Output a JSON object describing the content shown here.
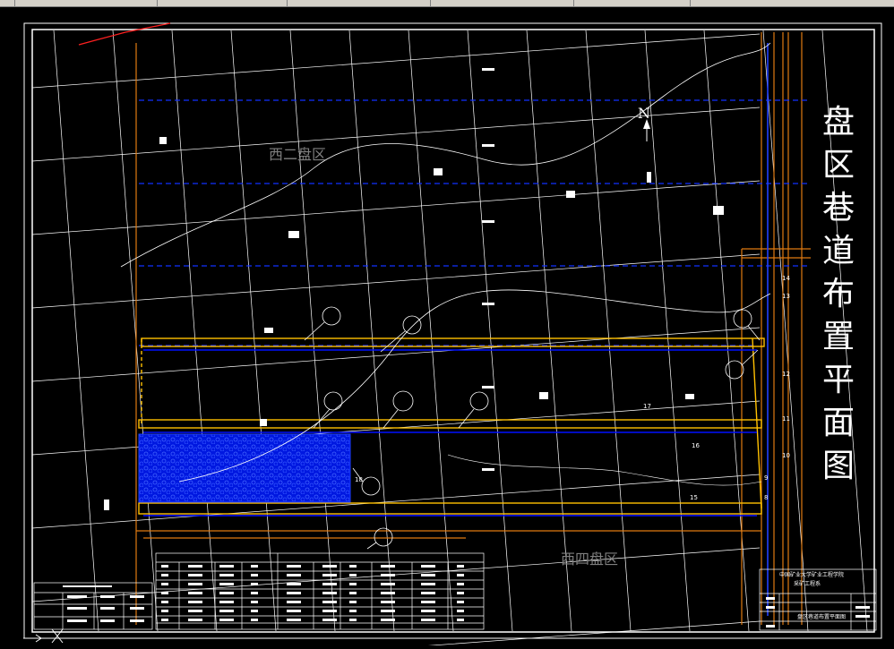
{
  "window": {
    "toolbar_visible": true
  },
  "drawing": {
    "title_chars": [
      "盘",
      "区",
      "巷",
      "道",
      "布",
      "置",
      "平",
      "面",
      "图"
    ],
    "panel_labels": [
      "西二盘区",
      "西四盘区"
    ],
    "north_label": "N",
    "school_line": "中国矿业大学矿业工程学院",
    "major_line": "采矿工程系",
    "sheet_name": "盘区巷道布置平面图",
    "point_numbers": [
      "17",
      "16",
      "15",
      "14",
      "13",
      "12",
      "11",
      "10",
      "9",
      "8",
      "18"
    ],
    "colors": {
      "background": "#000000",
      "border": "#ffffff",
      "roadway_yellow": "#ffc000",
      "roadway_blue": "#0000ff",
      "grid": "#ffffff",
      "boundary_orange": "#e07a10",
      "panel_label_gray": "#7f7f7f",
      "goaf_fill": "#1020ff"
    }
  }
}
